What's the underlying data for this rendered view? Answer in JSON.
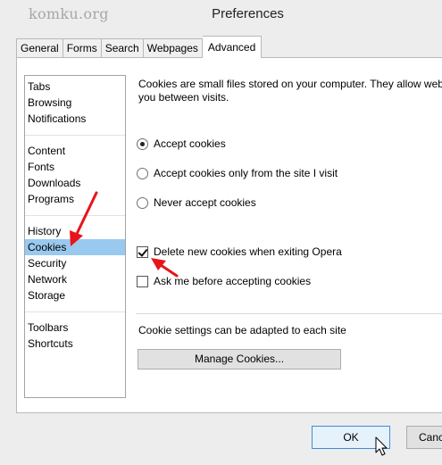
{
  "watermark": "komku.org",
  "window": {
    "title": "Preferences"
  },
  "tabs": [
    {
      "label": "General"
    },
    {
      "label": "Forms"
    },
    {
      "label": "Search"
    },
    {
      "label": "Webpages"
    },
    {
      "label": "Advanced",
      "active": true
    }
  ],
  "sidebar": {
    "items": [
      {
        "label": "Tabs"
      },
      {
        "label": "Browsing"
      },
      {
        "label": "Notifications"
      },
      {
        "label": "Content"
      },
      {
        "label": "Fonts"
      },
      {
        "label": "Downloads"
      },
      {
        "label": "Programs"
      },
      {
        "label": "History"
      },
      {
        "label": "Cookies",
        "selected": true
      },
      {
        "label": "Security"
      },
      {
        "label": "Network"
      },
      {
        "label": "Storage"
      },
      {
        "label": "Toolbars"
      },
      {
        "label": "Shortcuts"
      }
    ]
  },
  "cookies": {
    "description_line1": "Cookies are small files stored on your computer. They allow webs",
    "description_line2": "you between visits.",
    "radio_accept": "Accept cookies",
    "radio_accept_site": "Accept cookies only from the site I visit",
    "radio_never": "Never accept cookies",
    "check_delete": "Delete new cookies when exiting Opera",
    "check_delete_checked": true,
    "check_ask": "Ask me before accepting cookies",
    "check_ask_checked": false,
    "note": "Cookie settings can be adapted to each site",
    "manage_button": "Manage Cookies..."
  },
  "footer": {
    "ok": "OK",
    "cancel": "Canc"
  },
  "colors": {
    "annotation_arrow": "#e8141b",
    "selection": "#99c9ef",
    "default_button_border": "#3c8dd9"
  }
}
